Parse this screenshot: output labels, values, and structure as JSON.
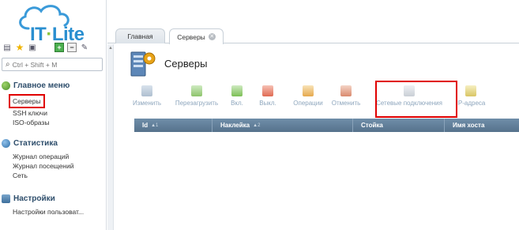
{
  "logo": {
    "brand": "IT",
    "brand2": "Lite"
  },
  "search": {
    "placeholder": "Ctrl + Shift + M"
  },
  "sidebar": {
    "sections": [
      {
        "title": "Главное меню",
        "items": [
          "Серверы",
          "SSH ключи",
          "ISO-образы"
        ]
      },
      {
        "title": "Статистика",
        "items": [
          "Журнал операций",
          "Журнал посещений",
          "Сеть"
        ]
      },
      {
        "title": "Настройки",
        "items": [
          "Настройки пользоват..."
        ]
      }
    ]
  },
  "tabs": [
    {
      "label": "Главная"
    },
    {
      "label": "Серверы"
    }
  ],
  "page": {
    "title": "Серверы"
  },
  "actions": [
    "Изменить",
    "Перезагрузить",
    "Вкл.",
    "Выкл.",
    "Операции",
    "Отменить",
    "Сетевые подключения",
    "IP-адреса"
  ],
  "table": {
    "columns": [
      {
        "label": "Id",
        "sort": "▲1"
      },
      {
        "label": "Наклейка",
        "sort": "▲2"
      },
      {
        "label": "Стойка",
        "sort": ""
      },
      {
        "label": "Имя хоста",
        "sort": ""
      }
    ]
  },
  "colors": {
    "accent": "#2a8fd0",
    "highlight": "#e00000",
    "header": "#5f7d97"
  }
}
